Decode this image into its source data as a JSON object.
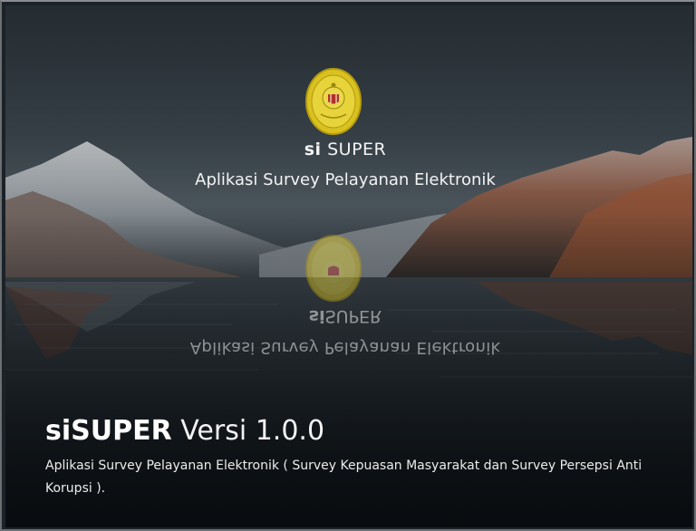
{
  "splash": {
    "brand_prefix": "si",
    "brand_name": "SUPER",
    "subtitle": "Aplikasi Survey Pelayanan Elektronik",
    "emblem_icon": "court-emblem-icon"
  },
  "footer": {
    "title_strong": "siSUPER",
    "title_version": "Versi 1.0.0",
    "description": "Aplikasi Survey Pelayanan Elektronik ( Survey Kepuasan Masyarakat dan Survey Persepsi Anti Korupsi )."
  },
  "colors": {
    "emblem_gold": "#e0c82a",
    "emblem_red": "#b0322a",
    "text": "#f3f3f3"
  }
}
